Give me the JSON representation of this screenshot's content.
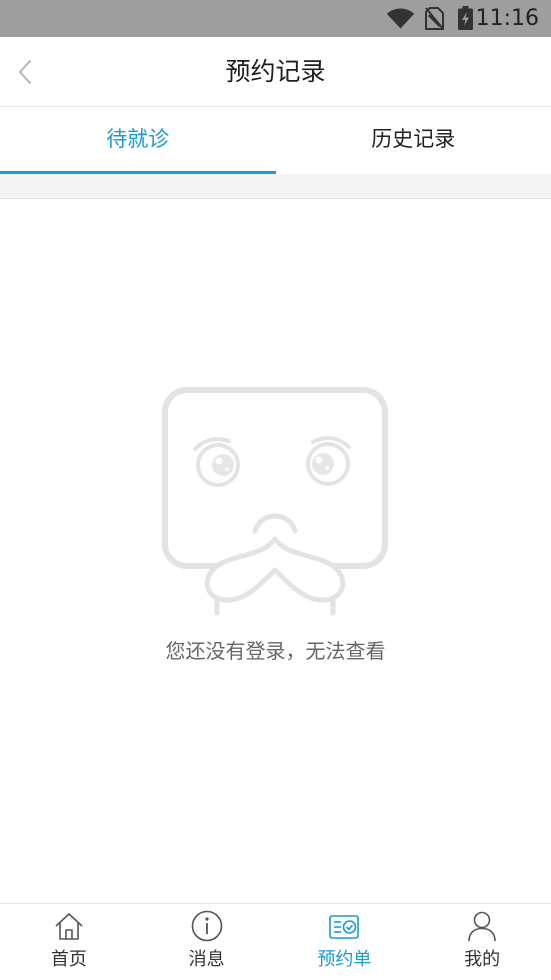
{
  "status_bar": {
    "time": "11:16",
    "icons": [
      "wifi-icon",
      "no-sim-icon",
      "battery-charging-icon"
    ]
  },
  "header": {
    "title": "预约记录",
    "back_icon": "chevron-left-icon"
  },
  "tabs": [
    {
      "label": "待就诊",
      "active": true
    },
    {
      "label": "历史记录",
      "active": false
    }
  ],
  "empty_state": {
    "illustration": "sad-face-illustration",
    "message": "您还没有登录，无法查看"
  },
  "bottom_nav": {
    "items": [
      {
        "label": "首页",
        "icon": "home-icon",
        "active": false
      },
      {
        "label": "消息",
        "icon": "info-icon",
        "active": false
      },
      {
        "label": "预约单",
        "icon": "appointment-icon",
        "active": true
      },
      {
        "label": "我的",
        "icon": "user-icon",
        "active": false
      }
    ]
  },
  "colors": {
    "accent": "#1a9ad6",
    "status_bar": "#9e9e9e",
    "text_primary": "#222222",
    "text_secondary": "#666666",
    "divider": "#e3e3e3",
    "strip": "#f4f4f4",
    "illustration": "#e3e3e3"
  }
}
